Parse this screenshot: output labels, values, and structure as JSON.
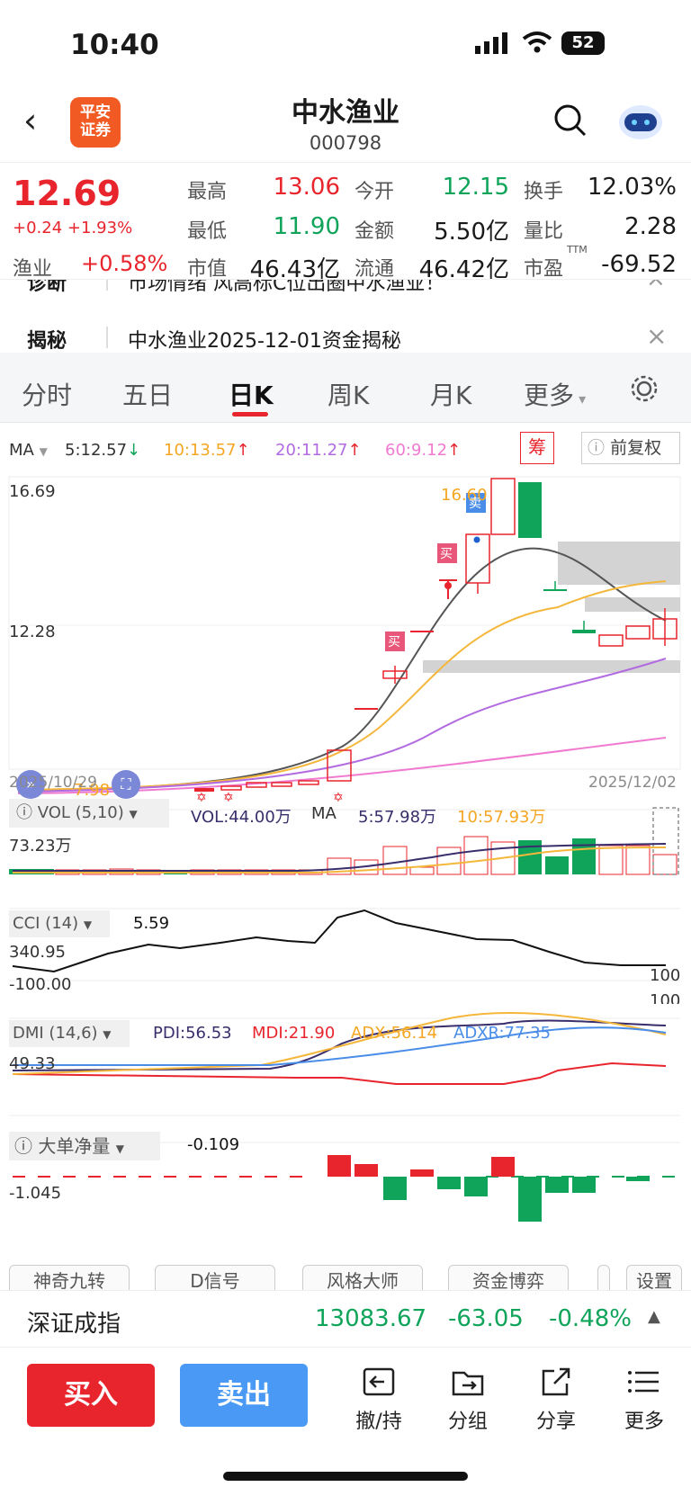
{
  "status": {
    "time": "10:40",
    "battery": "52"
  },
  "header": {
    "title": "中水渔业",
    "code": "000798",
    "logo_lines": [
      "平安",
      "证券"
    ]
  },
  "quote": {
    "price": "12.69",
    "change": "+0.24",
    "change_pct": "+1.93%",
    "sector_label": "渔业",
    "sector_change": "+0.58%",
    "rows": [
      [
        {
          "k": "最高",
          "v": "13.06",
          "c": "red"
        },
        {
          "k": "今开",
          "v": "12.15",
          "c": "green"
        },
        {
          "k": "换手",
          "v": "12.03%",
          "c": "black"
        }
      ],
      [
        {
          "k": "最低",
          "v": "11.90",
          "c": "green"
        },
        {
          "k": "金额",
          "v": "5.50亿",
          "c": "black"
        },
        {
          "k": "量比",
          "v": "2.28",
          "c": "black"
        }
      ],
      [
        {
          "k": "市值",
          "v": "46.43亿",
          "c": "black"
        },
        {
          "k": "流通",
          "v": "46.42亿",
          "c": "black"
        },
        {
          "k": "市盈",
          "v": "-69.52",
          "c": "black",
          "sup": "TTM"
        }
      ]
    ]
  },
  "notices": [
    {
      "tag": "诊断",
      "text": "市场情绪 风高标C位出圈中水渔业！"
    },
    {
      "tag": "揭秘",
      "text": "中水渔业2025-12-01资金揭秘"
    }
  ],
  "tabs": [
    "分时",
    "五日",
    "日K",
    "周K",
    "月K",
    "更多"
  ],
  "active_tab": "日K",
  "ma_legend": {
    "ma": "MA",
    "ma5": "5:12.57",
    "ma10": "10:13.57",
    "ma20": "20:11.27",
    "ma60": "60:9.12",
    "chip": "筹",
    "fq": "前复权"
  },
  "kline": {
    "ymax": "16.69",
    "ymid": "12.28",
    "ylow": "7.98",
    "peak_label": "16.60",
    "date_start": "2025/10/29",
    "date_end": "2025/12/02",
    "buy_label": "买",
    "sell_label": "卖"
  },
  "vol": {
    "title": "VOL (5,10)",
    "vol": "VOL:44.00万",
    "ma": "MA",
    "ma5": "5:57.98万",
    "ma10": "10:57.93万",
    "ymax": "73.23万"
  },
  "cci": {
    "title": "CCI (14)",
    "value": "5.59",
    "top": "340.95",
    "low": "-100.00",
    "r1": "100",
    "r2": "100"
  },
  "dmi": {
    "title": "DMI (14,6)",
    "pdi": "PDI:56.53",
    "mdi": "MDI:21.90",
    "adx": "ADX:56.14",
    "adxr": "ADXR:77.35",
    "ymid": "49.33"
  },
  "bigorder": {
    "title": "大单净量",
    "value": "-0.109",
    "ylow": "-1.045"
  },
  "indicator_buttons": [
    "神奇九转",
    "D信号",
    "风格大师",
    "资金博弈",
    "设置"
  ],
  "index": {
    "name": "深证成指",
    "value": "13083.67",
    "change": "-63.05",
    "pct": "-0.48%"
  },
  "actions": {
    "buy": "买入",
    "sell": "卖出",
    "tools": [
      "撤/持",
      "分组",
      "分享",
      "更多"
    ]
  },
  "colors": {
    "up": "#e8252d",
    "down": "#0fa45a",
    "buy_btn": "#e8252d",
    "sell_btn": "#4a9af5"
  }
}
